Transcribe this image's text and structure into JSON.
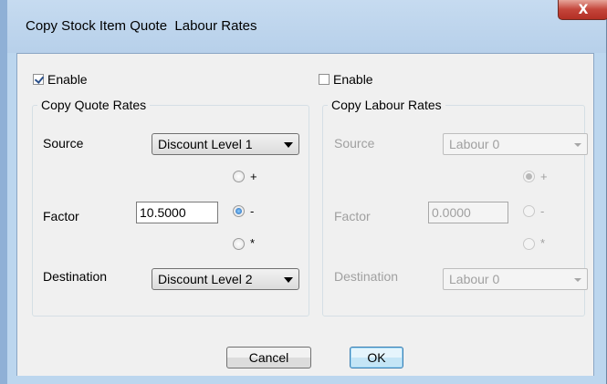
{
  "window": {
    "title": "Copy Stock Item Quote  Labour Rates",
    "close_glyph": "X"
  },
  "quote": {
    "enable_label": "Enable",
    "enable_checked": true,
    "group_title": "Copy Quote Rates",
    "source_label": "Source",
    "source_value": "Discount Level 1",
    "factor_label": "Factor",
    "factor_value": "10.5000",
    "radio_plus": "+",
    "radio_minus": "-",
    "radio_times": "*",
    "selected_operator": "-",
    "destination_label": "Destination",
    "destination_value": "Discount Level 2"
  },
  "labour": {
    "enable_label": "Enable",
    "enable_checked": false,
    "group_title": "Copy Labour Rates",
    "source_label": "Source",
    "source_value": "Labour 0",
    "factor_label": "Factor",
    "factor_value": "0.0000",
    "radio_plus": "+",
    "radio_minus": "-",
    "radio_times": "*",
    "selected_operator": "+",
    "destination_label": "Destination",
    "destination_value": "Labour 0"
  },
  "buttons": {
    "cancel": "Cancel",
    "ok": "OK"
  }
}
